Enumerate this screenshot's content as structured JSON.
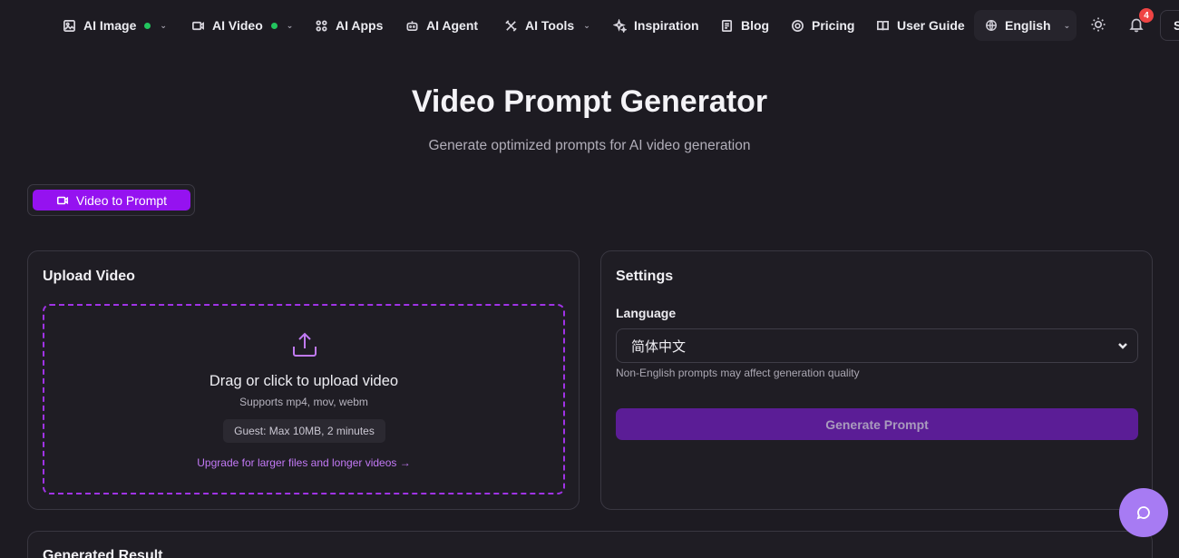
{
  "nav": {
    "items": [
      {
        "label": "AI Image",
        "icon": "image-icon",
        "dot": true,
        "dropdown": true
      },
      {
        "label": "AI Video",
        "icon": "video-icon",
        "dot": true,
        "dropdown": true
      },
      {
        "label": "AI Apps",
        "icon": "apps-icon"
      },
      {
        "label": "AI Agent",
        "icon": "bot-icon"
      },
      {
        "label": "AI Tools",
        "icon": "tools-icon",
        "dropdown": true
      },
      {
        "label": "Inspiration",
        "icon": "sparkles-icon"
      },
      {
        "label": "Blog",
        "icon": "document-icon"
      },
      {
        "label": "Pricing",
        "icon": "coin-icon"
      },
      {
        "label": "User Guide",
        "icon": "book-icon"
      }
    ],
    "language": "English",
    "notification_count": "4",
    "signin_partial": "S",
    "dot_color": "#22c55e"
  },
  "header": {
    "title": "Video Prompt Generator",
    "subtitle": "Generate optimized prompts for AI video generation"
  },
  "tabs": {
    "active_label": "Video to Prompt",
    "accent": "#9512f0"
  },
  "upload": {
    "title": "Upload Video",
    "main_text": "Drag or click to upload video",
    "formats": "Supports mp4, mov, webm",
    "limit": "Guest: Max 10MB, 2 minutes",
    "upgrade": "Upgrade for larger files and longer videos →"
  },
  "settings": {
    "title": "Settings",
    "language_label": "Language",
    "language_value": "简体中文",
    "hint": "Non-English prompts may affect generation quality",
    "generate_label": "Generate Prompt"
  },
  "result": {
    "title": "Generated Result"
  }
}
